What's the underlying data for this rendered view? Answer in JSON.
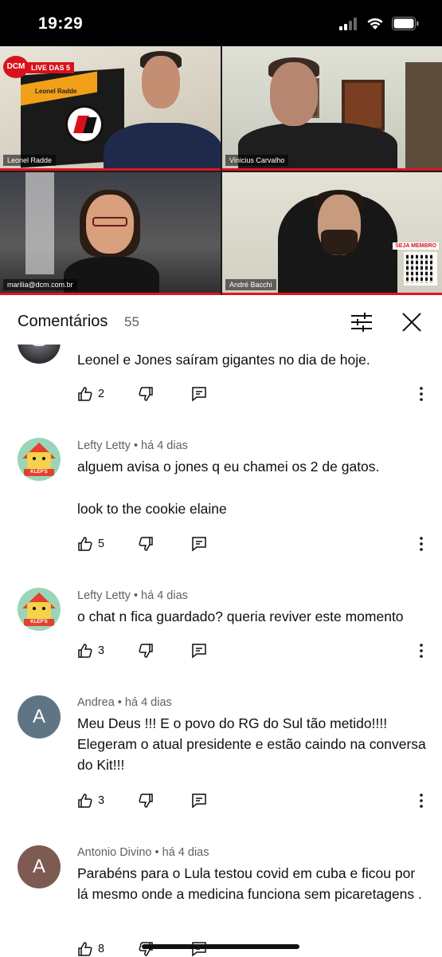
{
  "status_bar": {
    "time": "19:29"
  },
  "video": {
    "channel_logo": "DCM",
    "live_label": "LIVE DAS 5",
    "poster_text": "Leonel Radde",
    "participants": [
      {
        "name": "Leonel Radde"
      },
      {
        "name": "Vinicius Carvalho"
      },
      {
        "name": "marilia@dcm.com.br"
      },
      {
        "name": "André Bacchi"
      }
    ],
    "member_badge": "SEJA MEMBRO",
    "accent_color": "#e0141e"
  },
  "comments_header": {
    "title": "Comentários",
    "count": "55"
  },
  "comments": [
    {
      "author": "",
      "time": "",
      "text": "Leonel e Jones saíram gigantes no dia de hoje.",
      "likes": "2",
      "avatar": "photo"
    },
    {
      "author": "Lefty Letty",
      "time": "há 4 dias",
      "text_line1": "alguem avisa o jones q eu chamei os 2 de gatos.",
      "text_line2": "look to the cookie elaine",
      "likes": "5",
      "avatar": "klep",
      "avatar_tag": "KLEP'S"
    },
    {
      "author": "Lefty Letty",
      "time": "há 4 dias",
      "text": "o chat n fica guardado? queria reviver este momento",
      "likes": "3",
      "avatar": "klep",
      "avatar_tag": "KLEP'S"
    },
    {
      "author": "Andrea",
      "time": "há 4 dias",
      "text": "Meu Deus !!! E o povo do RG do Sul tão metido!!!! Elegeram o atual presidente e estão caindo na conversa do Kit!!!",
      "likes": "3",
      "avatar": "letter",
      "avatar_letter": "A",
      "avatar_color": "#5f7583"
    },
    {
      "author": "Antonio Divino",
      "time": "há 4 dias",
      "text": "Parabéns para o Lula testou covid em cuba e ficou por lá mesmo onde a medicina funciona sem picaretagens .",
      "likes": "8",
      "avatar": "letter",
      "avatar_letter": "A",
      "avatar_color": "#7d5a52"
    }
  ],
  "separator": "•"
}
